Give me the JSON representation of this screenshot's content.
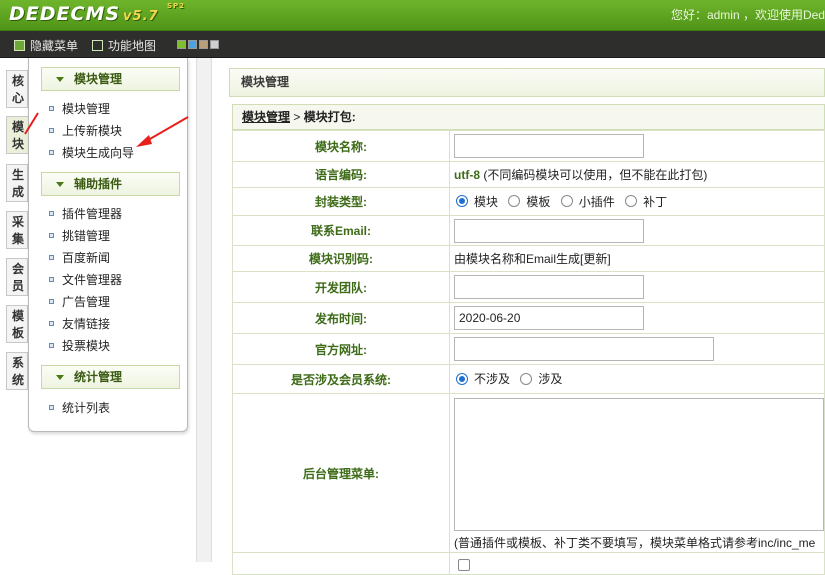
{
  "header": {
    "logo_text": "DEDECMS",
    "logo_version": "v5.7",
    "logo_sup": "SP2",
    "greeting": "您好：admin ，欢迎使用Ded"
  },
  "toolbar": {
    "hide_menu": "隐藏菜单",
    "function_map": "功能地图",
    "swatch_colors": [
      "#7fbf2f",
      "#4aa3e0",
      "#b8a07a",
      "#d0d0d0"
    ]
  },
  "left_tabs": [
    "核心",
    "模块",
    "生成",
    "采集",
    "会员",
    "模板",
    "系统"
  ],
  "left_tab_active": "模块",
  "menu": {
    "groups": [
      {
        "title": "模块管理",
        "items": [
          "模块管理",
          "上传新模块",
          "模块生成向导"
        ]
      },
      {
        "title": "辅助插件",
        "items": [
          "插件管理器",
          "挑错管理",
          "百度新闻",
          "文件管理器",
          "广告管理",
          "友情链接",
          "投票模块"
        ]
      },
      {
        "title": "统计管理",
        "items": [
          "统计列表"
        ]
      }
    ]
  },
  "main": {
    "page_title": "模块管理",
    "breadcrumb_link": "模块管理",
    "breadcrumb_sep": " > ",
    "breadcrumb_current": "模块打包:",
    "fields": {
      "name_label": "模块名称:",
      "name_value": "",
      "encoding_label": "语言编码:",
      "encoding_value": "utf-8",
      "encoding_note": " (不同编码模块可以使用，但不能在此打包)",
      "pack_label": "封装类型:",
      "pack_options": [
        "模块",
        "模板",
        "小插件",
        "补丁"
      ],
      "pack_selected": "模块",
      "email_label": "联系Email:",
      "email_value": "",
      "id_label": "模块识别码:",
      "id_value": "由模块名称和Email生成[更新]",
      "team_label": "开发团队:",
      "team_value": "",
      "date_label": "发布时间:",
      "date_value": "2020-06-20",
      "site_label": "官方网址:",
      "site_value": "",
      "member_label": "是否涉及会员系统:",
      "member_options": [
        "不涉及",
        "涉及"
      ],
      "member_selected": "不涉及",
      "admin_menu_label": "后台管理菜单:",
      "admin_menu_value": "",
      "admin_menu_note": "(普通插件或模板、补丁类不要填写，模块菜单格式请参考inc/inc_me"
    }
  },
  "colors": {
    "accent": "#5aa01f",
    "label_green": "#3d6b17",
    "arrow_red": "#e8201c"
  }
}
